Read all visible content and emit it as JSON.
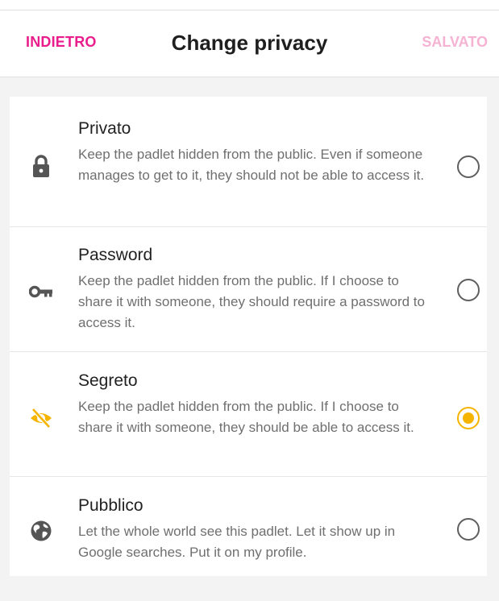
{
  "header": {
    "back_label": "INDIETRO",
    "title": "Change privacy",
    "save_label": "SALVATO"
  },
  "colors": {
    "accent": "#e91e8c",
    "accent_disabled": "#f6b2d3",
    "selected": "#f5b400",
    "icon": "#555555"
  },
  "options": [
    {
      "title": "Privato",
      "description": "Keep the padlet hidden from the public. Even if someone manages to get to it, they should not be able to access it.",
      "icon": "lock-icon",
      "selected": false
    },
    {
      "title": "Password",
      "description": "Keep the padlet hidden from the public. If I choose to share it with someone, they should require a password to access it.",
      "icon": "key-icon",
      "selected": false
    },
    {
      "title": "Segreto",
      "description": "Keep the padlet hidden from the public. If I choose to share it with someone, they should be able to access it.",
      "icon": "eye-off-icon",
      "selected": true
    },
    {
      "title": "Pubblico",
      "description": "Let the whole world see this padlet. Let it show up in Google searches. Put it on my profile.",
      "icon": "globe-icon",
      "selected": false
    }
  ]
}
